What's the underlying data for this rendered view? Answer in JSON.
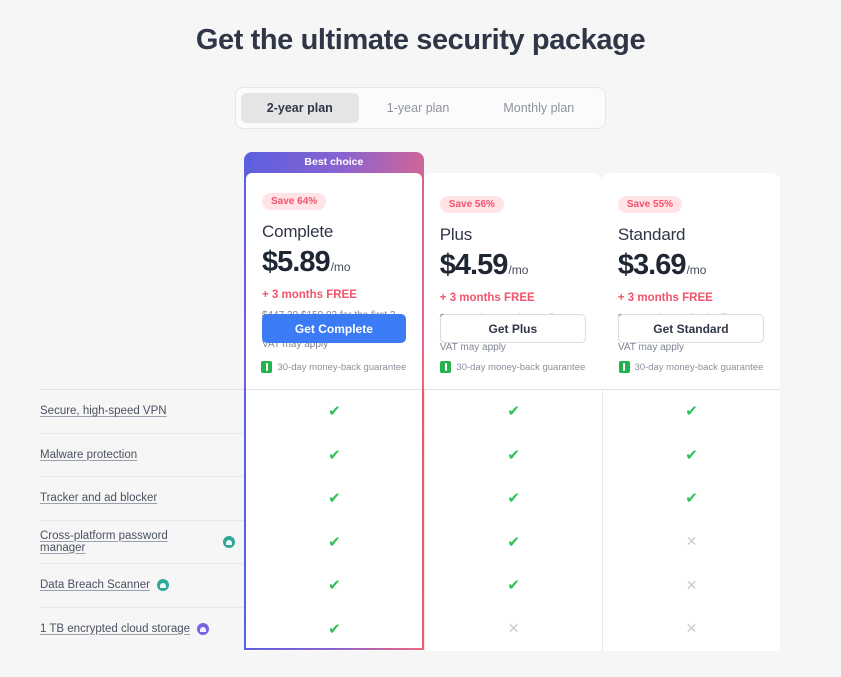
{
  "page": {
    "title": "Get the ultimate security package",
    "background_color": "#f6f6f6"
  },
  "plan_toggle": {
    "tabs": [
      {
        "label": "2-year plan",
        "active": true
      },
      {
        "label": "1-year plan",
        "active": false
      },
      {
        "label": "Monthly plan",
        "active": false
      }
    ]
  },
  "best_choice_label": "Best choice",
  "accent_colors": {
    "primary_button": "#3b7bf6",
    "save_badge_text": "#f2546b",
    "save_badge_bg": "#ffe3e6",
    "check": "#2fc159",
    "cross": "#c9ccd3",
    "gradient_start": "#5b5fe0",
    "gradient_end": "#f2667c",
    "shield_green": "#23b24b"
  },
  "plans": [
    {
      "name": "Complete",
      "save_badge": "Save 64%",
      "price": "$5.89",
      "price_period": "/mo",
      "free_months": "+ 3 months FREE",
      "old_price": "$447.39",
      "new_price": "$159.03",
      "term_text": "for the first 2 years",
      "vat_note": "VAT may apply",
      "cta_label": "Get Complete",
      "guarantee": "30-day money-back guarantee",
      "featured": true
    },
    {
      "name": "Plus",
      "save_badge": "Save 56%",
      "price": "$4.59",
      "price_period": "/mo",
      "free_months": "+ 3 months FREE",
      "old_price": "$286.66",
      "new_price": "$123.93",
      "term_text": "for the first 2 years",
      "vat_note": "VAT may apply",
      "cta_label": "Get Plus",
      "guarantee": "30-day money-back guarantee",
      "featured": false
    },
    {
      "name": "Standard",
      "save_badge": "Save 55%",
      "price": "$3.69",
      "price_period": "/mo",
      "free_months": "+ 3 months FREE",
      "old_price": "$223.83",
      "new_price": "$99.63",
      "term_text": "for the first 2 years",
      "vat_note": "VAT may apply",
      "cta_label": "Get Standard",
      "guarantee": "30-day money-back guarantee",
      "featured": false
    }
  ],
  "features": [
    {
      "label": "Secure, high-speed VPN",
      "badge": null,
      "complete": "check",
      "plus": "check",
      "standard": "check"
    },
    {
      "label": "Malware protection",
      "badge": null,
      "complete": "check",
      "plus": "check",
      "standard": "check"
    },
    {
      "label": "Tracker and ad blocker",
      "badge": null,
      "complete": "check",
      "plus": "check",
      "standard": "check"
    },
    {
      "label": "Cross-platform password manager",
      "badge": "teal",
      "complete": "check",
      "plus": "check",
      "standard": "cross"
    },
    {
      "label": "Data Breach Scanner",
      "badge": "teal",
      "complete": "check",
      "plus": "check",
      "standard": "cross"
    },
    {
      "label": "1 TB encrypted cloud storage",
      "badge": "purple",
      "complete": "check",
      "plus": "cross",
      "standard": "cross"
    }
  ],
  "symbols": {
    "check": "✔",
    "cross": "✕"
  }
}
